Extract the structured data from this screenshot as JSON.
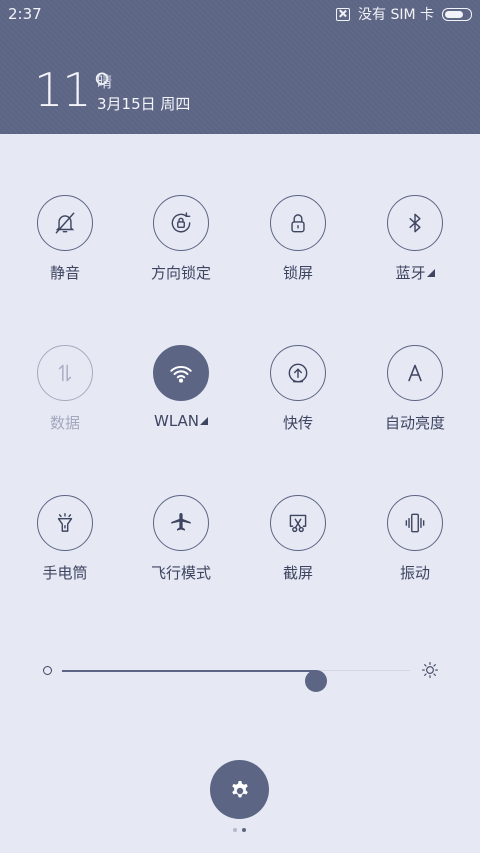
{
  "status_bar": {
    "time": "2:37",
    "sim_status": "没有 SIM 卡",
    "icons": [
      "sim-off-icon",
      "battery-icon"
    ],
    "battery_level": 0.8
  },
  "weather": {
    "temperature": "11°",
    "condition": "晴",
    "date": "3月15日 周四"
  },
  "toggles": [
    {
      "id": "silent",
      "label": "静音",
      "icon": "bell-off-icon",
      "state": "off",
      "has_menu": false
    },
    {
      "id": "rotation-lock",
      "label": "方向锁定",
      "icon": "rotation-lock-icon",
      "state": "off",
      "has_menu": false
    },
    {
      "id": "lock-screen",
      "label": "锁屏",
      "icon": "lock-icon",
      "state": "off",
      "has_menu": false
    },
    {
      "id": "bluetooth",
      "label": "蓝牙",
      "icon": "bluetooth-icon",
      "state": "off",
      "has_menu": true
    },
    {
      "id": "mobile-data",
      "label": "数据",
      "icon": "data-arrows-icon",
      "state": "disabled",
      "has_menu": false
    },
    {
      "id": "wlan",
      "label": "WLAN",
      "icon": "wifi-icon",
      "state": "on",
      "has_menu": true
    },
    {
      "id": "quick-transfer",
      "label": "快传",
      "icon": "upload-icon",
      "state": "off",
      "has_menu": false
    },
    {
      "id": "auto-brightness",
      "label": "自动亮度",
      "icon": "auto-a-icon",
      "state": "off",
      "has_menu": false
    },
    {
      "id": "flashlight",
      "label": "手电筒",
      "icon": "flashlight-icon",
      "state": "off",
      "has_menu": false
    },
    {
      "id": "airplane",
      "label": "飞行模式",
      "icon": "airplane-icon",
      "state": "off",
      "has_menu": false
    },
    {
      "id": "screenshot",
      "label": "截屏",
      "icon": "scissors-icon",
      "state": "off",
      "has_menu": false
    },
    {
      "id": "vibrate",
      "label": "振动",
      "icon": "vibrate-icon",
      "state": "off",
      "has_menu": false
    }
  ],
  "brightness": {
    "level": 0.73,
    "min_icon": "brightness-low-icon",
    "max_icon": "sun-icon"
  },
  "settings_button": {
    "icon": "gear-icon"
  },
  "pager": {
    "count": 2,
    "active": 1
  },
  "colors": {
    "accent": "#5c6584",
    "background": "#e6e8f4",
    "text": "#3e4560",
    "disabled": "#a3a8bc"
  }
}
